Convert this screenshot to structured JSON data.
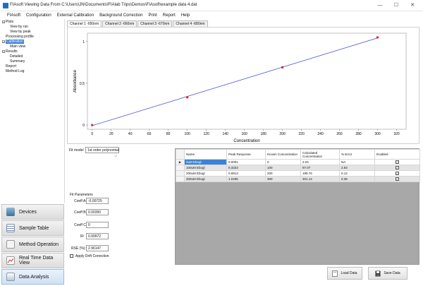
{
  "window": {
    "title": "FIAsoft Viewing Data From C:\\Users\\JN\\Documents\\FIAlab Trips\\Demos\\FIAsoft\\example data 4.dat",
    "minimize": "—",
    "maximize": "☐",
    "close": "✕"
  },
  "menu": [
    "FIAsoft",
    "Configuration",
    "External Calibration",
    "Background Correction",
    "Print",
    "Report",
    "Help"
  ],
  "tree": {
    "plots": "Plots",
    "view_by_run": "View by run",
    "view_by_peak": "View by peak",
    "processing_profile": "Processing profile",
    "calibration": "Calibration",
    "main_view": "Main view",
    "results": "Results",
    "detailed": "Detailed",
    "summary": "Summary",
    "report": "Report",
    "method_log": "Method Log"
  },
  "nav": {
    "devices": "Devices",
    "sample_table": "Sample Table",
    "method_operation": "Method Operation",
    "real_time_data_view": "Real Time Data View",
    "data_analysis": "Data Analysis"
  },
  "tabs": [
    "Channel 1 -650nm",
    "Channel 2 -660nm",
    "Channel 3 -670nm",
    "Channel 4 -680nm"
  ],
  "chart_data": {
    "type": "scatter",
    "title": "",
    "xlabel": "Concentration",
    "ylabel": "Absorbance",
    "xlim": [
      -5,
      330
    ],
    "ylim": [
      -0.05,
      1.1
    ],
    "x_ticks": [
      0,
      20,
      40,
      60,
      80,
      100,
      120,
      140,
      160,
      180,
      200,
      220,
      240,
      260,
      280,
      300,
      320
    ],
    "y_ticks": [
      0,
      0.5,
      1
    ],
    "y_tick_labels": [
      "0",
      "0.5",
      "1"
    ],
    "points": {
      "x": [
        0,
        100,
        200,
        300
      ],
      "y": [
        0.0001,
        0.3323,
        0.6913,
        1.0495
      ]
    },
    "fit_line": {
      "x": [
        0,
        300
      ],
      "y": [
        -0.00725,
        1.04275
      ]
    },
    "colors": {
      "points": "#d62728",
      "line": "#3344cc"
    }
  },
  "fit": {
    "model_label": "Fit model",
    "model_value": "1st order polynomial",
    "params_title": "Fit Parameters",
    "coeff_a_label": "Coeff A:",
    "coeff_a": "-0.00725",
    "coeff_b_label": "Coeff B:",
    "coeff_b": "0.00350",
    "coeff_c_label": "Coeff C:",
    "coeff_c": "0",
    "r2_label": "R²",
    "r2": "0.99972",
    "rse_label": "RSE (%):",
    "rse": "2.96147",
    "drift_label": "Apply Drift Correction"
  },
  "table": {
    "headers": [
      "Name",
      "Peak Response",
      "Known Concentration",
      "Calculated Concentration",
      "% Error",
      "Enabled"
    ],
    "rows": [
      {
        "name": "0uM Ebogl",
        "peak": "0.0001",
        "known": "0",
        "calc": "2.04",
        "err": "NA",
        "enabled": "✓"
      },
      {
        "name": "100uM Ebogl",
        "peak": "0.3323",
        "known": "100",
        "calc": "97.07",
        "err": "2.93",
        "enabled": "✓"
      },
      {
        "name": "200uM Ebogl",
        "peak": "0.6913",
        "known": "200",
        "calc": "199.76",
        "err": "0.12",
        "enabled": "✓"
      },
      {
        "name": "300uM Ebogl",
        "peak": "1.0495",
        "known": "300",
        "calc": "301.14",
        "err": "0.38",
        "enabled": "✓"
      }
    ]
  },
  "buttons": {
    "load": "Load Data",
    "save": "Save Data"
  }
}
